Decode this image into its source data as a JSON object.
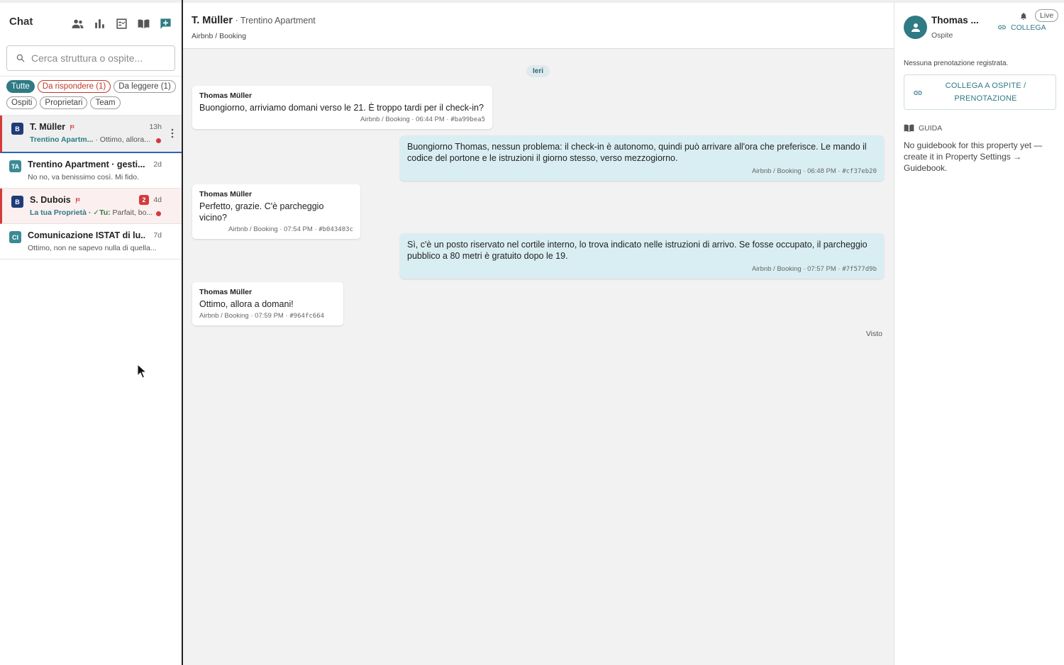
{
  "sidebar": {
    "title": "Chat",
    "icons": [
      "people-icon",
      "bar-chart-icon",
      "checklist-icon",
      "book-icon",
      "add-chat-icon"
    ],
    "search_placeholder": "Cerca struttura o ospite...",
    "filters": [
      {
        "label": "Tutte",
        "state": "active"
      },
      {
        "label": "Da rispondere (1)",
        "state": "red"
      },
      {
        "label": "Da leggere (1)",
        "state": "normal"
      },
      {
        "label": "Ospiti",
        "state": "normal"
      },
      {
        "label": "Proprietari",
        "state": "normal"
      },
      {
        "label": "Team",
        "state": "normal"
      }
    ],
    "conversations": [
      {
        "avatar": "B",
        "name": "T. Müller",
        "time": "13h",
        "prop": "Trentino Apartm...",
        "preview": " · Ottimo, allora...",
        "flag": true,
        "dot": true
      },
      {
        "avatar": "TA",
        "name": "Trentino Apartment · gesti...",
        "time": "2d",
        "preview": "No no, va benissimo così. Mi fido."
      },
      {
        "avatar": "B",
        "name": "S. Dubois",
        "time": "4d",
        "badge": "2",
        "prop": "La tua Proprietà",
        "tu": " · ✓Tu:",
        "preview": " Parfait, bo...",
        "flag": true,
        "dot": true
      },
      {
        "avatar": "CI",
        "name": "Comunicazione ISTAT di lu...",
        "time": "7d",
        "preview": "Ottimo, non ne sapevo nulla di quella..."
      }
    ]
  },
  "header": {
    "name": "T. Müller",
    "separator": " · ",
    "property": "Trentino Apartment",
    "channel": "Airbnb / Booking"
  },
  "thread": {
    "day_label": "Ieri",
    "messages": [
      {
        "sender": "Thomas Müller",
        "text": "Buongiorno, arriviamo domani verso le 21. È troppo tardi per il check-in?",
        "meta": "Airbnb / Booking · 06:44 PM · ",
        "hash": "#ba99bea5"
      },
      {
        "text": "Buongiorno Thomas, nessun problema: il check-in è autonomo, quindi può arrivare all'ora che preferisce. Le mando il codice del portone e le istruzioni il giorno stesso, verso mezzogiorno.",
        "meta": "Airbnb / Booking · 06:48 PM · ",
        "hash": "#cf37eb20"
      },
      {
        "sender": "Thomas Müller",
        "text": "Perfetto, grazie. C'è parcheggio vicino?",
        "meta": "Airbnb / Booking · 07:54 PM · ",
        "hash": "#b043403c"
      },
      {
        "text": "Sì, c'è un posto riservato nel cortile interno, lo trova indicato nelle istruzioni di arrivo. Se fosse occupato, il parcheggio pubblico a 80 metri è gratuito dopo le 19.",
        "meta": "Airbnb / Booking · 07:57 PM · ",
        "hash": "#7f577d9b"
      },
      {
        "sender": "Thomas Müller",
        "text": "Ottimo, allora a domani!",
        "meta": "Airbnb / Booking · 07:59 PM · ",
        "hash": "#964fc664"
      }
    ],
    "seen_label": "Visto"
  },
  "right_panel": {
    "guest_name": "Thomas ...",
    "guest_role": "Ospite",
    "live_label": "Live",
    "link_label": "COLLEGA",
    "no_booking": "Nessuna prenotazione registrata.",
    "link_button": "COLLEGA A OSPITE / PRENOTAZIONE",
    "guide_title": "GUIDA",
    "guide_text": "No guidebook for this property yet — create it in Property Settings → Guidebook."
  },
  "colors": {
    "accent": "#2e7a85",
    "alert": "#d23b3b",
    "outgoing_bubble": "#d9eef2"
  }
}
